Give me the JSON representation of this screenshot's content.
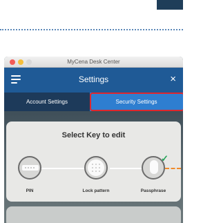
{
  "window": {
    "title": "MyCena Desk Center"
  },
  "appbar": {
    "title": "Settings",
    "menu_icon": "hamburger-menu-icon",
    "close_glyph": "×"
  },
  "tabs": [
    {
      "label": "Account Settings",
      "active": false
    },
    {
      "label": "Security Settings",
      "active": true
    }
  ],
  "card": {
    "title": "Select Key to edit",
    "keys": [
      {
        "label": "PIN",
        "icon": "pin-key-icon"
      },
      {
        "label": "Lock pattern",
        "icon": "lock-pattern-icon"
      },
      {
        "label": "Passphrase",
        "icon": "passphrase-icon",
        "selected": true
      }
    ],
    "check_glyph": "✓"
  },
  "colors": {
    "appbar": "#1f5a96",
    "tab_bar": "#1d3a5a",
    "active_tab": "#2e7ed0",
    "highlight": "#e0262c",
    "check": "#27a35a",
    "dash": "#f08a2a"
  }
}
